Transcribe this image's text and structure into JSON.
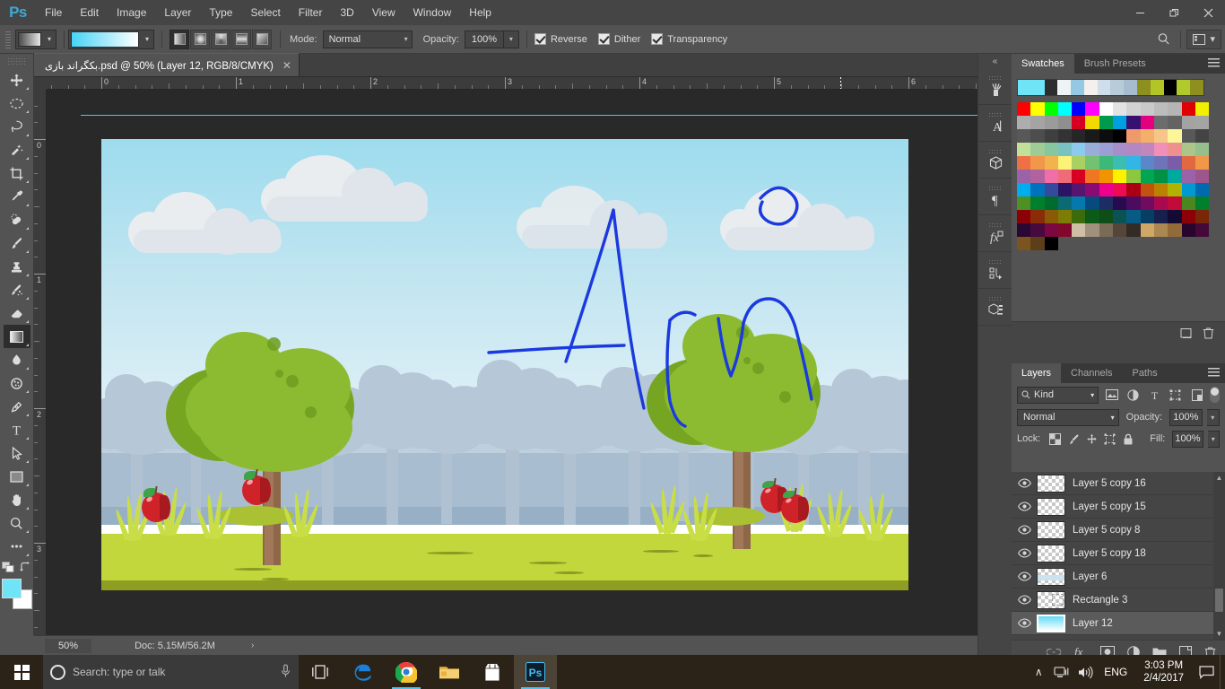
{
  "app": {
    "name": "Adobe Photoshop",
    "logo_text": "Ps"
  },
  "menubar": {
    "items": [
      "File",
      "Edit",
      "Image",
      "Layer",
      "Type",
      "Select",
      "Filter",
      "3D",
      "View",
      "Window",
      "Help"
    ]
  },
  "window_controls": {
    "minimize": "—",
    "restore": "❐",
    "close": "✕"
  },
  "options_bar": {
    "tool": "gradient-tool",
    "gradient_preset_label": "",
    "gradient_from_color": "#46d4f5",
    "gradient_to_color": "#ffffff",
    "gradient_types": [
      "Linear Gradient",
      "Radial Gradient",
      "Angle Gradient",
      "Reflected Gradient",
      "Diamond Gradient"
    ],
    "active_gradient_type": "Linear Gradient",
    "mode_label": "Mode:",
    "mode_value": "Normal",
    "opacity_label": "Opacity:",
    "opacity_value": "100%",
    "checkboxes": [
      {
        "label": "Reverse",
        "checked": true
      },
      {
        "label": "Dither",
        "checked": true
      },
      {
        "label": "Transparency",
        "checked": true
      }
    ]
  },
  "document_tab": {
    "title": "بکگراند بازی.psd @ 50% (Layer 12, RGB/8/CMYK)",
    "close_glyph": "✕"
  },
  "toolbar": {
    "tools": [
      {
        "name": "move-tool",
        "has_submenu": true
      },
      {
        "name": "marquee-tool",
        "has_submenu": true
      },
      {
        "name": "lasso-tool",
        "has_submenu": true
      },
      {
        "name": "quick-selection-tool",
        "has_submenu": true
      },
      {
        "name": "crop-tool",
        "has_submenu": true
      },
      {
        "name": "eyedropper-tool",
        "has_submenu": true
      },
      {
        "name": "healing-brush-tool",
        "has_submenu": true
      },
      {
        "name": "brush-tool",
        "has_submenu": true
      },
      {
        "name": "clone-stamp-tool",
        "has_submenu": true
      },
      {
        "name": "history-brush-tool",
        "has_submenu": true
      },
      {
        "name": "eraser-tool",
        "has_submenu": true
      },
      {
        "name": "gradient-tool",
        "has_submenu": true,
        "active": true
      },
      {
        "name": "blur-tool",
        "has_submenu": true
      },
      {
        "name": "dodge-tool",
        "has_submenu": true
      },
      {
        "name": "pen-tool",
        "has_submenu": true
      },
      {
        "name": "type-tool",
        "has_submenu": true
      },
      {
        "name": "path-selection-tool",
        "has_submenu": true
      },
      {
        "name": "rectangle-tool",
        "has_submenu": true
      },
      {
        "name": "hand-tool",
        "has_submenu": true
      },
      {
        "name": "zoom-tool",
        "has_submenu": true
      },
      {
        "name": "edit-toolbar-tool",
        "has_submenu": false
      }
    ],
    "foreground_color": "#6fe4f7",
    "background_color": "#ffffff"
  },
  "rulers": {
    "unit": "inches",
    "horizontal_labels": [
      "0",
      "1",
      "2",
      "3",
      "4",
      "5",
      "6"
    ],
    "vertical_labels": [
      "0",
      "1",
      "2",
      "3"
    ]
  },
  "canvas": {
    "artwork_title": "game background",
    "signature_text": "Amir",
    "signature_color": "#1a3adf",
    "sky_top_color": "#9ddcee",
    "sky_bottom_color": "#e2f1f7",
    "ground_color": "#c2d73c",
    "ground_shade_color": "#8f9e22",
    "tree_crown_dark": "#76a522",
    "tree_crown_light": "#8cbb32",
    "tree_trunk_color": "#8d6747",
    "apple_color": "#cf2229",
    "guide_color": "#39d2e0"
  },
  "status_bar": {
    "zoom": "50%",
    "doc_label": "Doc: 5.15M/56.2M",
    "expand_glyph": "›"
  },
  "dock_strip": {
    "collapse_glyph": "«",
    "buttons": [
      {
        "name": "tool-presets-icon"
      },
      {
        "name": "character-icon"
      },
      {
        "name": "3d-icon"
      },
      {
        "name": "paragraph-icon"
      },
      {
        "name": "styles-icon"
      },
      {
        "name": "actions-icon"
      },
      {
        "name": "3d-materials-icon"
      }
    ]
  },
  "swatches_panel": {
    "tabs": [
      {
        "label": "Swatches",
        "active": true
      },
      {
        "label": "Brush Presets",
        "active": false
      }
    ],
    "recent": [
      "#6fe4f7",
      "#6fe4f7",
      "#2d2d2d",
      "#eef3f5",
      "#95c8e2",
      "#f3f0ee",
      "#cfdeea",
      "#b8cbd8",
      "#a7bdcf",
      "#8d901e",
      "#b2c426",
      "#000000",
      "#b0c92d",
      "#8d901e"
    ],
    "grid": [
      [
        "#ff0000",
        "#ffff00",
        "#00ff00",
        "#00ffff",
        "#0000ff",
        "#ff00ff",
        "#ffffff",
        "#e3e3e3",
        "#d2d2d2",
        "#c9c9c9",
        "#bcbcbc",
        "#b5b5b5"
      ],
      [
        "#adadad",
        "#a4a4a4",
        "#9b9b9b",
        "#8f8f8f",
        "#d80022",
        "#f2d900",
        "#009a4e",
        "#00a0e0",
        "#38106f",
        "#e20081",
        "#6c6c6c",
        "#636363"
      ],
      [
        "#585858",
        "#4d4d4d",
        "#3f3f3f",
        "#333333",
        "#262626",
        "#1a1a1a",
        "#0d0d0d",
        "#000000",
        "#ef9a6b",
        "#f2b06a",
        "#f5c58a",
        "#fcf59a"
      ],
      [
        "#c3e09a",
        "#9ecb96",
        "#86c79f",
        "#7ac2c2",
        "#8ccbee",
        "#9aadd9",
        "#9b9fd4",
        "#a68fc9",
        "#b487c0",
        "#c186bb",
        "#f18fb6",
        "#ef8f90"
      ],
      [
        "#ef7045",
        "#f0974a",
        "#f2b24e",
        "#fbf378",
        "#a8d062",
        "#72c272",
        "#3cb878",
        "#3cbdb1",
        "#33b5e5",
        "#5b86c8",
        "#6d74b8",
        "#7a5ca8"
      ],
      [
        "#9a63a8",
        "#b2629f",
        "#f06fa8",
        "#ef6b78",
        "#d80022",
        "#ef7622",
        "#f29400",
        "#fff200",
        "#8dc63f",
        "#00a651",
        "#009144",
        "#00a99d"
      ],
      [
        "#00aeef",
        "#0071bc",
        "#344a9c",
        "#2b1466",
        "#57166e",
        "#8b0b74",
        "#ec008c",
        "#ed0b52",
        "#ab0013",
        "#c35210",
        "#ba8200",
        "#b2b200"
      ],
      [
        "#4f9023",
        "#00802c",
        "#006b2e",
        "#0b6b74",
        "#0579ae",
        "#08497e",
        "#1c2d63",
        "#270a52",
        "#4b0b5e",
        "#700b5f",
        "#aa0a4d",
        "#c20b38"
      ],
      [
        "#8c0008",
        "#8a2c07",
        "#8a5a07",
        "#7c7c07",
        "#3c6b0c",
        "#0b5a18",
        "#0c4d18",
        "#0c5154",
        "#075b85",
        "#073e63",
        "#161f4d",
        "#140a33"
      ],
      [
        "#2b0733",
        "#480a3e",
        "#7b0840",
        "#82082b",
        "#cfc0a5",
        "#a1917c",
        "#7a6b57",
        "#544639",
        "#332b26",
        "#cfa868",
        "#ab8751",
        "#936b38"
      ],
      [
        "#7b5420",
        "#5c3e18",
        "#000000",
        "",
        "",
        "",
        "",
        "",
        "",
        "",
        "",
        ""
      ]
    ]
  },
  "layers_panel": {
    "tabs": [
      {
        "label": "Layers",
        "active": true
      },
      {
        "label": "Channels",
        "active": false
      },
      {
        "label": "Paths",
        "active": false
      }
    ],
    "filter_label": "Kind",
    "filter_icons": [
      "pixel-filter-icon",
      "adjustment-filter-icon",
      "type-filter-icon",
      "shape-filter-icon",
      "smartobject-filter-icon"
    ],
    "blend_mode": "Normal",
    "opacity_label": "Opacity:",
    "opacity_value": "100%",
    "lock_label": "Lock:",
    "lock_icons": [
      "lock-transparent-pixels-icon",
      "lock-image-pixels-icon",
      "lock-position-icon",
      "lock-artboard-icon",
      "lock-all-icon"
    ],
    "fill_label": "Fill:",
    "fill_value": "100%",
    "layers": [
      {
        "name": "Layer 5 copy 16",
        "visible": true,
        "selected": false,
        "thumb": "transparent"
      },
      {
        "name": "Layer 5 copy 15",
        "visible": true,
        "selected": false,
        "thumb": "transparent"
      },
      {
        "name": "Layer 5 copy 8",
        "visible": true,
        "selected": false,
        "thumb": "transparent"
      },
      {
        "name": "Layer 5 copy 18",
        "visible": true,
        "selected": false,
        "thumb": "transparent"
      },
      {
        "name": "Layer 6",
        "visible": true,
        "selected": false,
        "thumb": "sky"
      },
      {
        "name": "Rectangle 3",
        "visible": true,
        "selected": false,
        "thumb": "shape"
      },
      {
        "name": "Layer 12",
        "visible": true,
        "selected": true,
        "thumb": "gradient"
      }
    ],
    "footer_buttons": [
      "link-layers-icon",
      "layer-style-fx-icon",
      "layer-mask-icon",
      "adjustment-layer-icon",
      "new-group-icon",
      "new-layer-icon",
      "delete-layer-icon"
    ]
  },
  "taskbar": {
    "start_name": "start-button",
    "search_placeholder": "Search: type or talk",
    "apps": [
      {
        "name": "task-view-icon",
        "running": false
      },
      {
        "name": "edge-icon",
        "running": false
      },
      {
        "name": "chrome-icon",
        "running": true
      },
      {
        "name": "file-explorer-icon",
        "running": false
      },
      {
        "name": "store-icon",
        "running": false
      },
      {
        "name": "photoshop-icon",
        "running": true,
        "active": true
      }
    ],
    "tray": {
      "chevron": "∧",
      "network_icon": "network-icon",
      "volume_icon": "volume-icon",
      "language": "ENG",
      "time": "3:03 PM",
      "date": "2/4/2017",
      "action_center_icon": "action-center-icon"
    }
  }
}
